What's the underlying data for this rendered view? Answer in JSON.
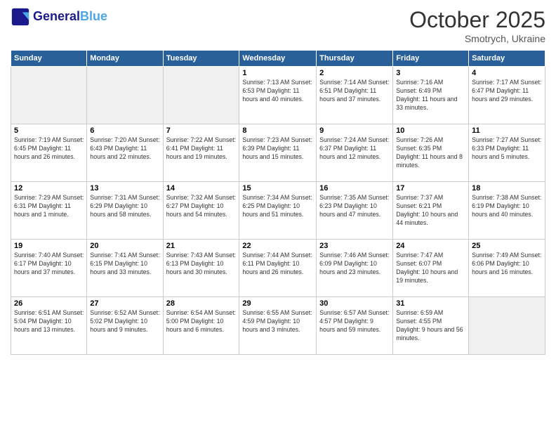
{
  "header": {
    "logo_line1": "General",
    "logo_line2": "Blue",
    "month": "October 2025",
    "location": "Smotrych, Ukraine"
  },
  "weekdays": [
    "Sunday",
    "Monday",
    "Tuesday",
    "Wednesday",
    "Thursday",
    "Friday",
    "Saturday"
  ],
  "weeks": [
    [
      {
        "day": "",
        "info": ""
      },
      {
        "day": "",
        "info": ""
      },
      {
        "day": "",
        "info": ""
      },
      {
        "day": "1",
        "info": "Sunrise: 7:13 AM\nSunset: 6:53 PM\nDaylight: 11 hours and 40 minutes."
      },
      {
        "day": "2",
        "info": "Sunrise: 7:14 AM\nSunset: 6:51 PM\nDaylight: 11 hours and 37 minutes."
      },
      {
        "day": "3",
        "info": "Sunrise: 7:16 AM\nSunset: 6:49 PM\nDaylight: 11 hours and 33 minutes."
      },
      {
        "day": "4",
        "info": "Sunrise: 7:17 AM\nSunset: 6:47 PM\nDaylight: 11 hours and 29 minutes."
      }
    ],
    [
      {
        "day": "5",
        "info": "Sunrise: 7:19 AM\nSunset: 6:45 PM\nDaylight: 11 hours and 26 minutes."
      },
      {
        "day": "6",
        "info": "Sunrise: 7:20 AM\nSunset: 6:43 PM\nDaylight: 11 hours and 22 minutes."
      },
      {
        "day": "7",
        "info": "Sunrise: 7:22 AM\nSunset: 6:41 PM\nDaylight: 11 hours and 19 minutes."
      },
      {
        "day": "8",
        "info": "Sunrise: 7:23 AM\nSunset: 6:39 PM\nDaylight: 11 hours and 15 minutes."
      },
      {
        "day": "9",
        "info": "Sunrise: 7:24 AM\nSunset: 6:37 PM\nDaylight: 11 hours and 12 minutes."
      },
      {
        "day": "10",
        "info": "Sunrise: 7:26 AM\nSunset: 6:35 PM\nDaylight: 11 hours and 8 minutes."
      },
      {
        "day": "11",
        "info": "Sunrise: 7:27 AM\nSunset: 6:33 PM\nDaylight: 11 hours and 5 minutes."
      }
    ],
    [
      {
        "day": "12",
        "info": "Sunrise: 7:29 AM\nSunset: 6:31 PM\nDaylight: 11 hours and 1 minute."
      },
      {
        "day": "13",
        "info": "Sunrise: 7:31 AM\nSunset: 6:29 PM\nDaylight: 10 hours and 58 minutes."
      },
      {
        "day": "14",
        "info": "Sunrise: 7:32 AM\nSunset: 6:27 PM\nDaylight: 10 hours and 54 minutes."
      },
      {
        "day": "15",
        "info": "Sunrise: 7:34 AM\nSunset: 6:25 PM\nDaylight: 10 hours and 51 minutes."
      },
      {
        "day": "16",
        "info": "Sunrise: 7:35 AM\nSunset: 6:23 PM\nDaylight: 10 hours and 47 minutes."
      },
      {
        "day": "17",
        "info": "Sunrise: 7:37 AM\nSunset: 6:21 PM\nDaylight: 10 hours and 44 minutes."
      },
      {
        "day": "18",
        "info": "Sunrise: 7:38 AM\nSunset: 6:19 PM\nDaylight: 10 hours and 40 minutes."
      }
    ],
    [
      {
        "day": "19",
        "info": "Sunrise: 7:40 AM\nSunset: 6:17 PM\nDaylight: 10 hours and 37 minutes."
      },
      {
        "day": "20",
        "info": "Sunrise: 7:41 AM\nSunset: 6:15 PM\nDaylight: 10 hours and 33 minutes."
      },
      {
        "day": "21",
        "info": "Sunrise: 7:43 AM\nSunset: 6:13 PM\nDaylight: 10 hours and 30 minutes."
      },
      {
        "day": "22",
        "info": "Sunrise: 7:44 AM\nSunset: 6:11 PM\nDaylight: 10 hours and 26 minutes."
      },
      {
        "day": "23",
        "info": "Sunrise: 7:46 AM\nSunset: 6:09 PM\nDaylight: 10 hours and 23 minutes."
      },
      {
        "day": "24",
        "info": "Sunrise: 7:47 AM\nSunset: 6:07 PM\nDaylight: 10 hours and 19 minutes."
      },
      {
        "day": "25",
        "info": "Sunrise: 7:49 AM\nSunset: 6:06 PM\nDaylight: 10 hours and 16 minutes."
      }
    ],
    [
      {
        "day": "26",
        "info": "Sunrise: 6:51 AM\nSunset: 5:04 PM\nDaylight: 10 hours and 13 minutes."
      },
      {
        "day": "27",
        "info": "Sunrise: 6:52 AM\nSunset: 5:02 PM\nDaylight: 10 hours and 9 minutes."
      },
      {
        "day": "28",
        "info": "Sunrise: 6:54 AM\nSunset: 5:00 PM\nDaylight: 10 hours and 6 minutes."
      },
      {
        "day": "29",
        "info": "Sunrise: 6:55 AM\nSunset: 4:59 PM\nDaylight: 10 hours and 3 minutes."
      },
      {
        "day": "30",
        "info": "Sunrise: 6:57 AM\nSunset: 4:57 PM\nDaylight: 9 hours and 59 minutes."
      },
      {
        "day": "31",
        "info": "Sunrise: 6:59 AM\nSunset: 4:55 PM\nDaylight: 9 hours and 56 minutes."
      },
      {
        "day": "",
        "info": ""
      }
    ]
  ]
}
